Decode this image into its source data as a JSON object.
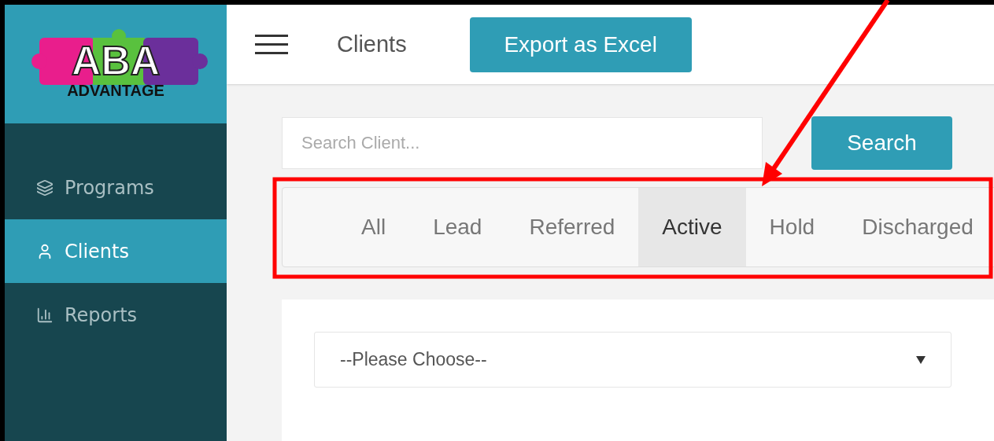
{
  "logo": {
    "title": "ABA",
    "subtitle": "ADVANTAGE"
  },
  "sidebar": {
    "items": [
      {
        "label": "Programs",
        "selected": false
      },
      {
        "label": "Clients",
        "selected": true
      },
      {
        "label": "Reports",
        "selected": false
      }
    ]
  },
  "header": {
    "title": "Clients",
    "export_button": "Export as Excel"
  },
  "search": {
    "placeholder": "Search Client...",
    "button": "Search"
  },
  "tabs": [
    {
      "label": "All",
      "selected": false
    },
    {
      "label": "Lead",
      "selected": false
    },
    {
      "label": "Referred",
      "selected": false
    },
    {
      "label": "Active",
      "selected": true
    },
    {
      "label": "Hold",
      "selected": false
    },
    {
      "label": "Discharged",
      "selected": false
    }
  ],
  "select": {
    "value": "--Please Choose--"
  }
}
